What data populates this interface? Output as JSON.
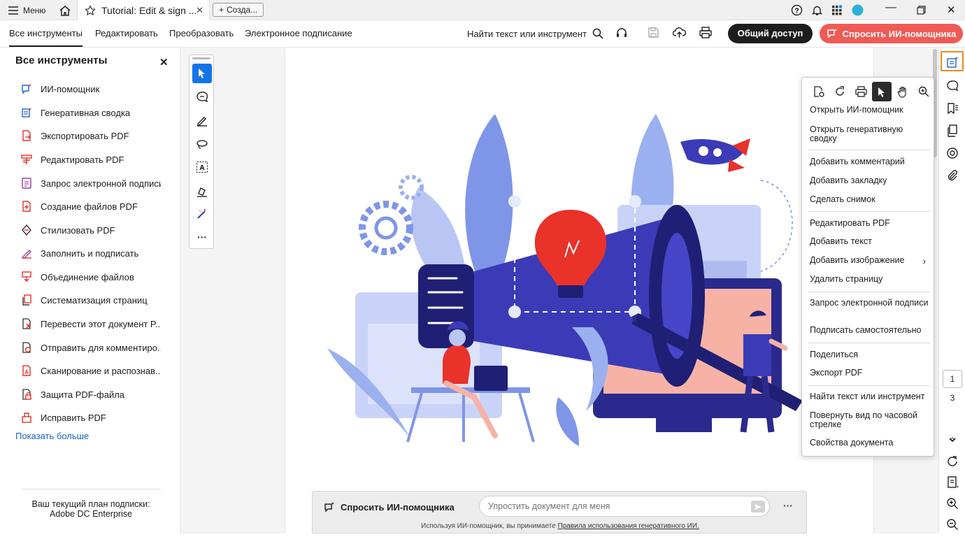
{
  "titlebar": {
    "menu_label": "Меню",
    "active_tab": "Tutorial: Edit & sign ...",
    "create_label": "Созда..."
  },
  "toolbar": {
    "tabs": [
      {
        "label": "Все инструменты",
        "active": true
      },
      {
        "label": "Редактировать",
        "active": false
      },
      {
        "label": "Преобразовать",
        "active": false
      },
      {
        "label": "Электронное подписание",
        "active": false
      }
    ],
    "find_label": "Найти текст или инструмент",
    "share_label": "Общий доступ",
    "ask_ai_label": "Спросить ИИ-помощника"
  },
  "left_panel": {
    "title": "Все инструменты",
    "items": [
      {
        "label": "ИИ-помощник",
        "icon": "ai-assistant-icon"
      },
      {
        "label": "Генеративная сводка",
        "icon": "generative-summary-icon"
      },
      {
        "label": "Экспортировать PDF",
        "icon": "export-pdf-icon"
      },
      {
        "label": "Редактировать PDF",
        "icon": "edit-pdf-icon"
      },
      {
        "label": "Запрос электронной подписи",
        "icon": "request-signature-icon"
      },
      {
        "label": "Создание файлов PDF",
        "icon": "create-pdf-icon"
      },
      {
        "label": "Стилизовать PDF",
        "icon": "stylize-pdf-icon"
      },
      {
        "label": "Заполнить и подписать",
        "icon": "fill-sign-icon"
      },
      {
        "label": "Объединение файлов",
        "icon": "combine-files-icon"
      },
      {
        "label": "Систематизация страниц",
        "icon": "organize-pages-icon"
      },
      {
        "label": "Перевести этот документ P...",
        "icon": "translate-icon"
      },
      {
        "label": "Отправить для комментиро...",
        "icon": "send-comment-icon"
      },
      {
        "label": "Сканирование и распознав...",
        "icon": "scan-ocr-icon"
      },
      {
        "label": "Защита PDF-файла",
        "icon": "protect-pdf-icon"
      },
      {
        "label": "Исправить PDF",
        "icon": "fix-pdf-icon"
      }
    ],
    "show_more": "Показать больше",
    "plan_line1": "Ваш текущий план подписки:",
    "plan_line2": "Adobe DC Enterprise"
  },
  "context_menu": {
    "items": [
      {
        "label": "Открыть ИИ-помощник"
      },
      {
        "label": "Открыть генеративную сводку"
      },
      {
        "label": "Добавить комментарий"
      },
      {
        "label": "Добавить закладку"
      },
      {
        "label": "Сделать снимок"
      },
      {
        "label": "Редактировать PDF"
      },
      {
        "label": "Добавить текст"
      },
      {
        "label": "Добавить изображение"
      },
      {
        "label": "Удалить страницу"
      },
      {
        "label": "Запрос электронной подписи"
      },
      {
        "label": "Подписать самостоятельно"
      },
      {
        "label": "Поделиться"
      },
      {
        "label": "Экспорт PDF"
      },
      {
        "label": "Найти текст или инструмент"
      },
      {
        "label": "Повернуть вид по часовой стрелке"
      },
      {
        "label": "Свойства документа"
      }
    ]
  },
  "pagination": {
    "current": "1",
    "total": "3"
  },
  "ai_bar": {
    "label": "Спросить ИИ-помощника",
    "placeholder": "Упростить документ для меня",
    "note_prefix": "Используя ИИ-помощник, вы принимаете ",
    "note_link": "Правила использования генеративного ИИ."
  },
  "colors": {
    "accent_blue": "#1473e6",
    "ask_ai_red": "#f05a55",
    "share_black": "#1d1d1d",
    "active_outline": "#f28a1a",
    "illustration_navy": "#3b3bb8",
    "illustration_red": "#e8322a"
  }
}
